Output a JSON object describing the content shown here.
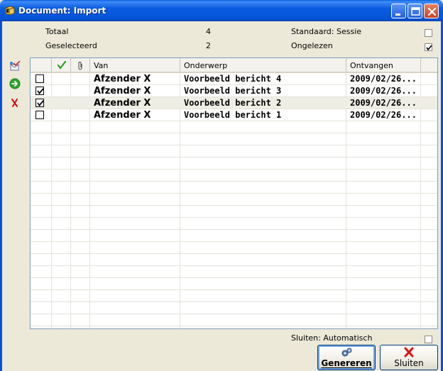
{
  "window": {
    "title": "Document: Import",
    "controls": [
      "minimize",
      "maximize",
      "close"
    ]
  },
  "summary": {
    "total_label": "Totaal",
    "total_value": "4",
    "selected_label": "Geselecteerd",
    "selected_value": "2",
    "standard_label": "Standaard: Sessie",
    "standard_checked": false,
    "unread_label": "Ongelezen",
    "unread_checked": true
  },
  "sidebar": {
    "icons": [
      "select-all-icon",
      "go-arrow-icon",
      "delete-icon"
    ]
  },
  "grid": {
    "columns": [
      "",
      "check-icon",
      "paperclip-icon",
      "Van",
      "Onderwerp",
      "Ontvangen"
    ],
    "headers": {
      "van": "Van",
      "onderwerp": "Onderwerp",
      "ontvangen": "Ontvangen"
    },
    "rows": [
      {
        "checked": false,
        "van": "Afzender X",
        "onderwerp": "Voorbeeld bericht 4",
        "ontvangen": "2009/02/26..."
      },
      {
        "checked": true,
        "van": "Afzender X",
        "onderwerp": "Voorbeeld bericht 3",
        "ontvangen": "2009/02/26..."
      },
      {
        "checked": true,
        "van": "Afzender X",
        "onderwerp": "Voorbeeld bericht 2",
        "ontvangen": "2009/02/26..."
      },
      {
        "checked": false,
        "van": "Afzender X",
        "onderwerp": "Voorbeeld bericht 1",
        "ontvangen": "2009/02/26..."
      }
    ],
    "selected_row": 2
  },
  "footer": {
    "close_mode_label": "Sluiten: Automatisch",
    "close_mode_checked": false,
    "generate_label": "Genereren",
    "close_label": "Sluiten"
  },
  "colors": {
    "titlebar": "#0a5fe0",
    "window_bg": "#ece9d8",
    "selected_row": "#efeee4",
    "check_green": "#2a9d1e",
    "delete_red": "#d01010"
  }
}
